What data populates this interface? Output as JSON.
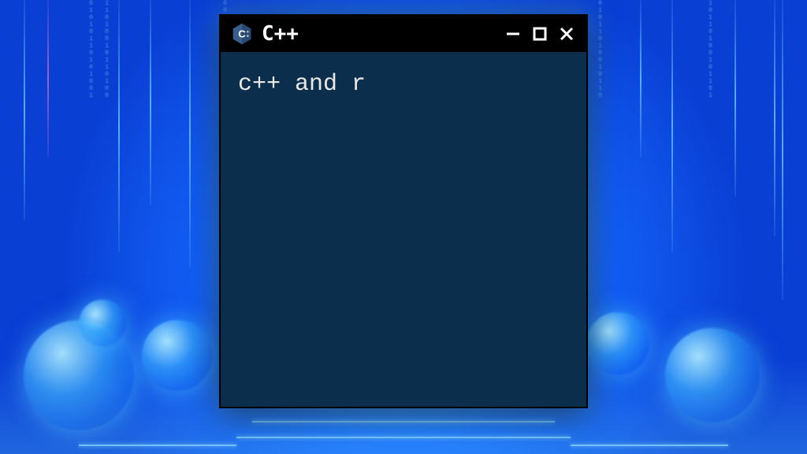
{
  "window": {
    "title": "C++",
    "icon_name": "cpp-logo-icon"
  },
  "content": {
    "text": "c++ and r"
  },
  "controls": {
    "minimize": "minimize",
    "maximize": "maximize",
    "close": "close"
  }
}
